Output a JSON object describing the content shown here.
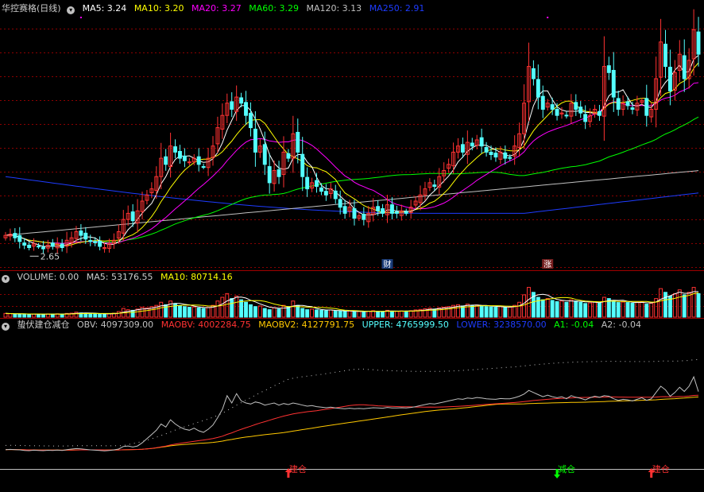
{
  "colors": {
    "up": "#ff3232",
    "down": "#54ffff",
    "ma5": "#ffffff",
    "ma10": "#ffff00",
    "ma20": "#ff00ff",
    "ma60": "#00ff00",
    "ma120": "#c0c0c0",
    "ma250": "#1e3cff",
    "obv": "#c0c0c0",
    "maobv": "#ff3232",
    "maobv2": "#ffc800",
    "upper": "#54ffff",
    "lower": "#1e3cff",
    "a1": "#00ff00",
    "a2": "#c0c0c0"
  },
  "main": {
    "title": "华控赛格(日线)",
    "ma_labels": {
      "ma5": "MA5: 3.24",
      "ma10": "MA10: 3.20",
      "ma20": "MA20: 3.27",
      "ma60": "MA60: 3.29",
      "ma120": "MA120: 3.13",
      "ma250": "MA250: 2.91"
    },
    "low_label": "2.65",
    "events": {
      "cai": "财",
      "zhang": "涨"
    }
  },
  "volume": {
    "title": "VOLUME: 0.00",
    "ma5": "MA5: 53176.55",
    "ma10": "MA10: 80714.16"
  },
  "indicator": {
    "title": "蛰伏建仓减仓",
    "obv": "OBV: 4097309.00",
    "maobv": "MAOBV: 4002284.75",
    "maobv2": "MAOBV2: 4127791.75",
    "upper": "UPPER: 4765999.50",
    "lower": "LOWER: 3238570.00",
    "a1": "A1: -0.04",
    "a2": "A2: -0.04",
    "signals": [
      {
        "label": "建仓",
        "index": 60,
        "dir": "up"
      },
      {
        "label": "减仓",
        "index": 117,
        "dir": "down"
      },
      {
        "label": "建仓",
        "index": 137,
        "dir": "up"
      }
    ]
  },
  "chart_data": {
    "type": "candlestick",
    "y_range": [
      2.6,
      4.6
    ],
    "vol_range": [
      0,
      250000
    ],
    "obv_range": [
      2500000,
      5200000
    ],
    "low_marker": {
      "index": 5,
      "value": 2.65
    },
    "closes": [
      2.82,
      2.83,
      2.8,
      2.77,
      2.74,
      2.72,
      2.75,
      2.73,
      2.71,
      2.74,
      2.73,
      2.75,
      2.72,
      2.78,
      2.8,
      2.85,
      2.82,
      2.79,
      2.77,
      2.76,
      2.73,
      2.72,
      2.75,
      2.78,
      2.85,
      2.95,
      3.0,
      2.94,
      3.02,
      3.1,
      3.15,
      3.2,
      3.3,
      3.45,
      3.4,
      3.55,
      3.5,
      3.45,
      3.43,
      3.42,
      3.45,
      3.4,
      3.38,
      3.45,
      3.55,
      3.7,
      3.8,
      3.9,
      3.85,
      3.95,
      3.9,
      3.8,
      3.7,
      3.5,
      3.55,
      3.4,
      3.25,
      3.35,
      3.3,
      3.5,
      3.45,
      3.65,
      3.5,
      3.3,
      3.2,
      3.25,
      3.22,
      3.18,
      3.15,
      3.2,
      3.12,
      3.05,
      3.0,
      3.05,
      2.96,
      2.98,
      2.95,
      3.0,
      3.05,
      3.02,
      3.0,
      3.07,
      3.0,
      3.0,
      3.02,
      3.0,
      3.05,
      3.1,
      3.15,
      3.2,
      3.25,
      3.22,
      3.3,
      3.35,
      3.4,
      3.5,
      3.55,
      3.5,
      3.58,
      3.55,
      3.6,
      3.55,
      3.5,
      3.48,
      3.46,
      3.5,
      3.45,
      3.45,
      3.55,
      3.65,
      3.9,
      4.2,
      4.1,
      3.95,
      3.85,
      3.9,
      3.85,
      3.8,
      3.82,
      3.8,
      3.9,
      3.85,
      3.82,
      3.75,
      3.8,
      3.85,
      3.8,
      4.2,
      4.15,
      3.95,
      3.85,
      3.9,
      3.88,
      3.85,
      3.9,
      3.92,
      3.8,
      3.85,
      4.1,
      4.4,
      4.2,
      4.0,
      4.15,
      4.3,
      4.1,
      4.25,
      4.5,
      4.3
    ],
    "volumes": [
      30000,
      28000,
      25000,
      24000,
      26000,
      22000,
      25000,
      24000,
      23000,
      26000,
      25000,
      27000,
      24000,
      30000,
      32000,
      40000,
      34000,
      30000,
      28000,
      27000,
      25000,
      24000,
      28000,
      32000,
      45000,
      70000,
      60000,
      55000,
      65000,
      80000,
      75000,
      85000,
      95000,
      120000,
      100000,
      130000,
      110000,
      90000,
      85000,
      80000,
      82000,
      75000,
      70000,
      78000,
      95000,
      130000,
      160000,
      190000,
      150000,
      170000,
      140000,
      120000,
      100000,
      85000,
      90000,
      70000,
      60000,
      75000,
      65000,
      95000,
      85000,
      130000,
      95000,
      70000,
      60000,
      65000,
      58000,
      55000,
      52000,
      58000,
      50000,
      48000,
      45000,
      50000,
      44000,
      46000,
      42000,
      48000,
      52000,
      47000,
      45000,
      55000,
      48000,
      47000,
      50000,
      46000,
      52000,
      58000,
      62000,
      68000,
      72000,
      65000,
      75000,
      80000,
      85000,
      95000,
      100000,
      90000,
      105000,
      95000,
      98000,
      90000,
      85000,
      82000,
      80000,
      86000,
      78000,
      80000,
      95000,
      120000,
      180000,
      240000,
      200000,
      160000,
      140000,
      150000,
      135000,
      125000,
      130000,
      120000,
      140000,
      130000,
      120000,
      110000,
      115000,
      125000,
      115000,
      160000,
      150000,
      130000,
      118000,
      122000,
      118000,
      112000,
      120000,
      125000,
      105000,
      112000,
      150000,
      230000,
      200000,
      170000,
      190000,
      220000,
      180000,
      200000,
      240000,
      190000
    ],
    "obv": [
      2990000,
      2995000,
      2990000,
      2985000,
      2975000,
      2970000,
      2980000,
      2975000,
      2970000,
      2978000,
      2975000,
      2982000,
      2975000,
      2990000,
      3000000,
      3010000,
      3005000,
      2995000,
      2985000,
      2980000,
      2975000,
      2965000,
      2975000,
      2985000,
      3000000,
      3050000,
      3060000,
      3040000,
      3060000,
      3120000,
      3200000,
      3280000,
      3360000,
      3480000,
      3420000,
      3560000,
      3480000,
      3420000,
      3380000,
      3360000,
      3400000,
      3350000,
      3320000,
      3380000,
      3460000,
      3600000,
      3760000,
      4020000,
      3880000,
      4060000,
      3920000,
      3880000,
      3860000,
      3900000,
      3880000,
      3840000,
      3860000,
      3880000,
      3840000,
      3870000,
      3850000,
      3880000,
      3860000,
      3840000,
      3820000,
      3830000,
      3810000,
      3800000,
      3790000,
      3800000,
      3785000,
      3775000,
      3770000,
      3780000,
      3770000,
      3775000,
      3770000,
      3780000,
      3790000,
      3785000,
      3780000,
      3795000,
      3785000,
      3785000,
      3790000,
      3785000,
      3795000,
      3810000,
      3830000,
      3850000,
      3870000,
      3860000,
      3880000,
      3900000,
      3920000,
      3940000,
      3960000,
      3950000,
      3975000,
      3965000,
      3985000,
      3975000,
      3960000,
      3955000,
      3950000,
      3965000,
      3960000,
      3960000,
      3980000,
      4010000,
      4050000,
      4120000,
      4080000,
      4040000,
      4000000,
      4030000,
      4000000,
      3980000,
      4000000,
      3960000,
      4020000,
      3990000,
      3970000,
      3940000,
      3980000,
      4010000,
      3990000,
      4020000,
      4010000,
      3960000,
      3930000,
      3950000,
      3940000,
      3920000,
      3950000,
      3980000,
      3930000,
      3960000,
      4080000,
      4200000,
      4130000,
      4010000,
      4080000,
      4180000,
      4100000,
      4200000,
      4380000,
      4097309
    ]
  }
}
